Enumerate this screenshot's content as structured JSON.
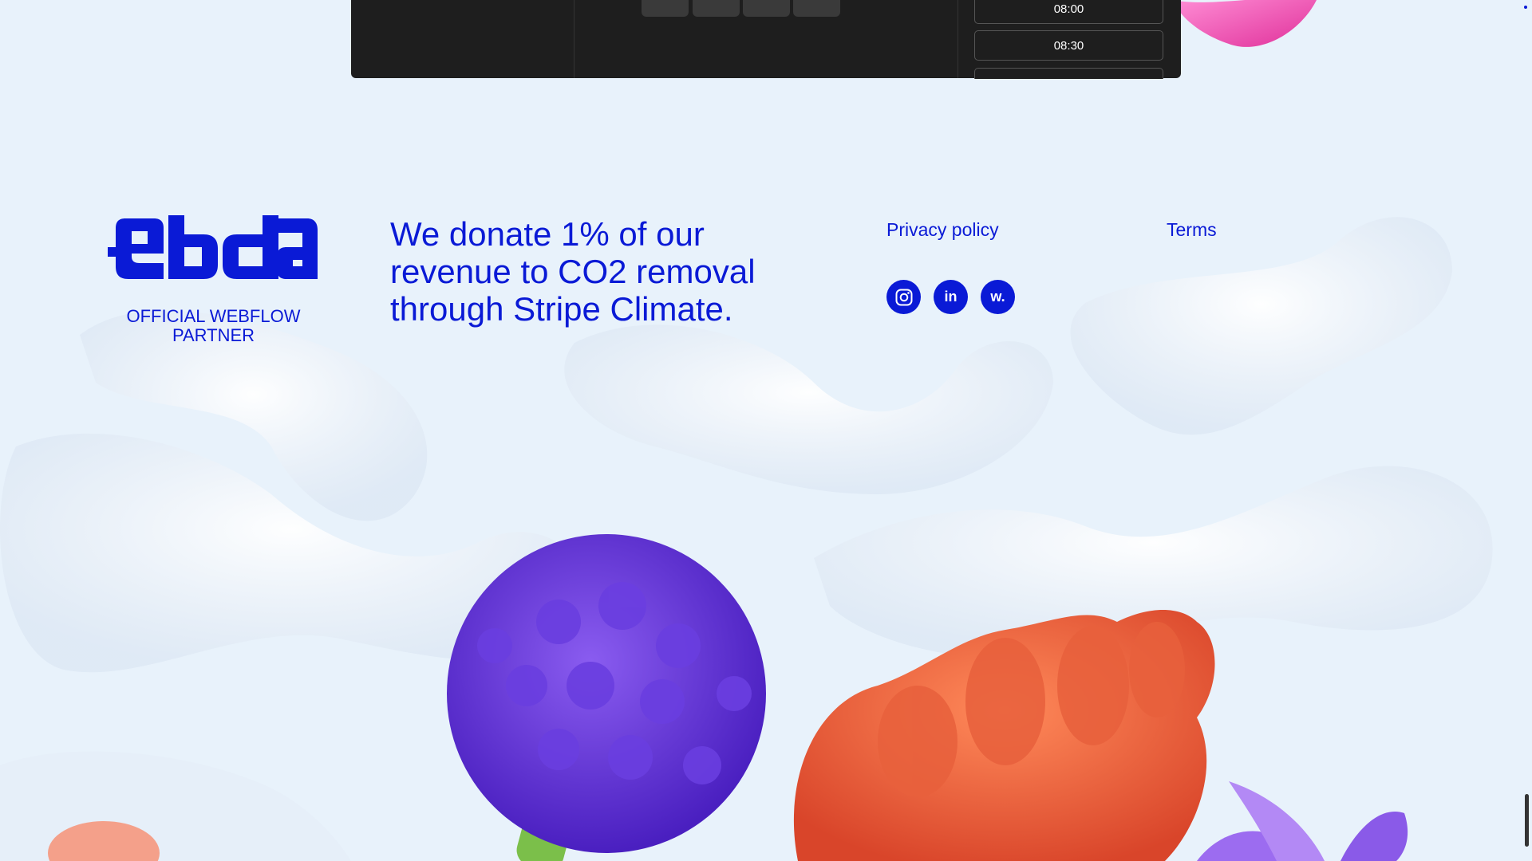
{
  "booking": {
    "time_slots": [
      "08:00",
      "08:30"
    ]
  },
  "footer": {
    "partner_label": "OFFICIAL WEBFLOW PARTNER",
    "donate_text": "We donate 1% of our revenue to CO2 removal through Stripe Climate.",
    "links": {
      "privacy": "Privacy policy",
      "terms": "Terms"
    },
    "social": [
      {
        "icon": "instagram-icon"
      },
      {
        "icon": "linkedin-icon",
        "label": "in"
      },
      {
        "icon": "webflow-icon",
        "label": "w."
      }
    ]
  },
  "colors": {
    "brand": "#0a1ad6",
    "background": "#e8f2fb",
    "panel": "#1e1e1e"
  }
}
